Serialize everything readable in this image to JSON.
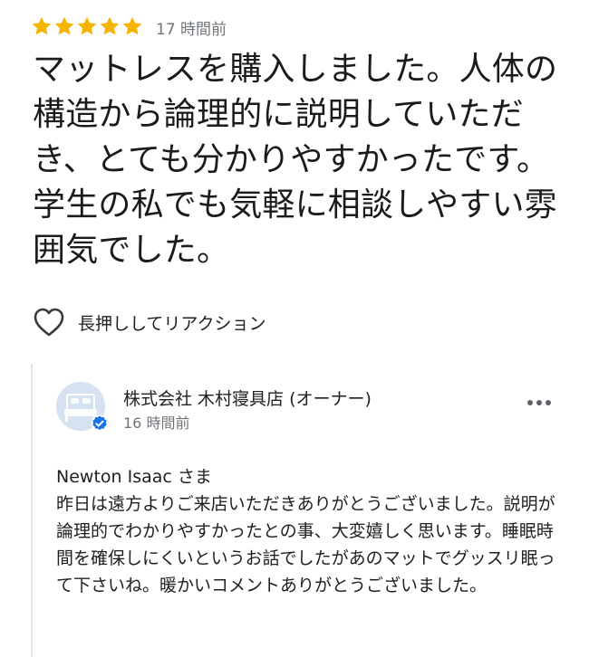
{
  "review": {
    "rating": 5,
    "max_rating": 5,
    "star_color": "#f5b400",
    "time_ago": "17 時間前",
    "text": "マットレスを購入しました。人体の構造から論理的に説明していただき、とても分かりやすかったです。学生の私でも気軽に相談しやすい雰囲気でした。",
    "reaction_label": "長押ししてリアクション",
    "reaction_icon": "heart-outline-icon"
  },
  "owner_reply": {
    "owner_name": "株式会社 木村寝具店 (オーナー)",
    "time_ago": "16 時間前",
    "verified_color": "#1a73e8",
    "more_icon": "more-horizontal-icon",
    "text": "Newton Isaac さま\n昨日は遠方よりご来店いただきありがとうございました。説明が論理的でわかりやすかったとの事、大変嬉しく思います。睡眠時間を確保しにくいというお話でしたがあのマットでグッスリ眠って下さいね。暖かいコメントありがとうございました。"
  }
}
